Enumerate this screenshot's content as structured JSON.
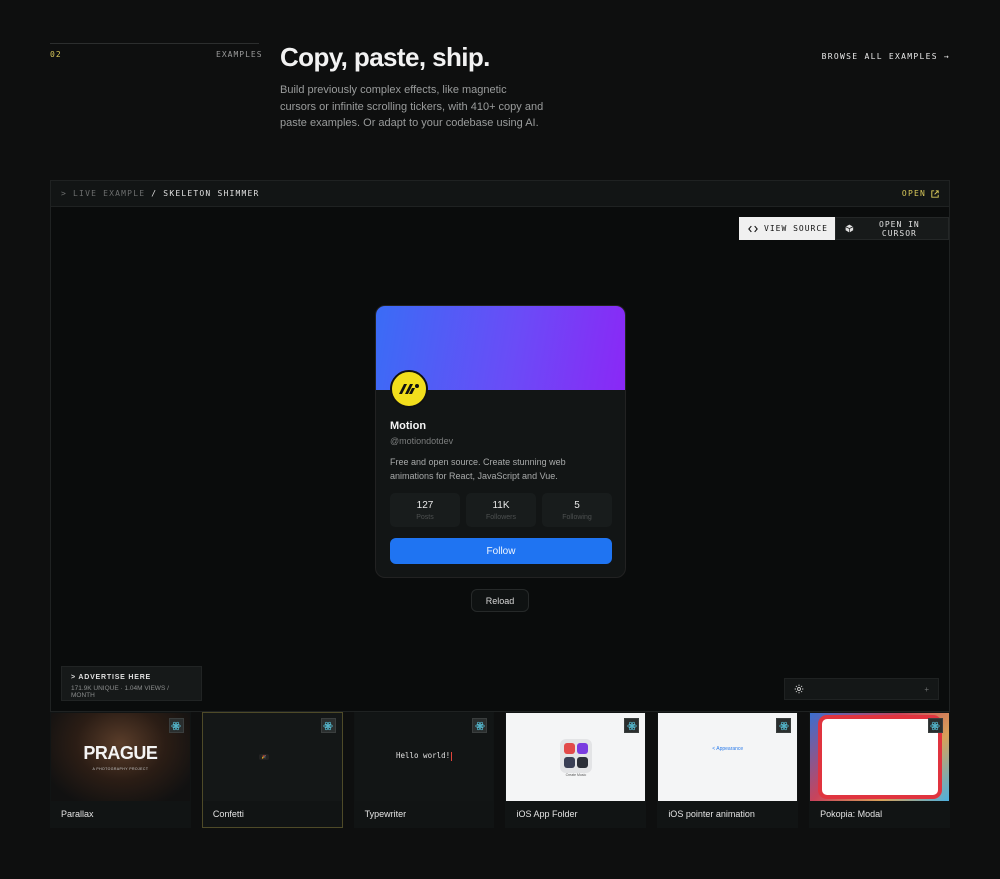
{
  "section": {
    "number": "02",
    "label": "EXAMPLES",
    "title": "Copy, paste, ship.",
    "description": "Build previously complex effects, like magnetic cursors or infinite scrolling tickers, with 410+ copy and paste examples. Or adapt to your codebase using AI.",
    "browse_label": "BROWSE ALL EXAMPLES",
    "browse_arrow": "→"
  },
  "panel": {
    "breadcrumb_prefix": "> LIVE EXAMPLE",
    "breadcrumb_sep": " / ",
    "breadcrumb_current": "SKELETON SHIMMER",
    "open_label": "OPEN",
    "view_source_label": "VIEW SOURCE",
    "open_cursor_label": "OPEN IN CURSOR",
    "reload_label": "Reload"
  },
  "profile": {
    "name": "Motion",
    "handle": "@motiondotdev",
    "bio": "Free and open source. Create stunning web animations for React, JavaScript and Vue.",
    "stats": [
      {
        "value": "127",
        "label": "Posts"
      },
      {
        "value": "11K",
        "label": "Followers"
      },
      {
        "value": "5",
        "label": "Following"
      }
    ],
    "follow_label": "Follow",
    "banner_colors": [
      "#3a6cf6",
      "#8a28f6"
    ],
    "avatar_color": "#f2de1c"
  },
  "ad": {
    "title": "> ADVERTISE HERE",
    "stats": "171.9K UNIQUE · 1.04M VIEWS / MONTH"
  },
  "settings": {
    "plus": "+"
  },
  "thumbnails": [
    {
      "label": "Parallax",
      "art_title": "PRAGUE",
      "art_sub": "A PHOTOGRAPHY PROJECT"
    },
    {
      "label": "Confetti"
    },
    {
      "label": "Typewriter",
      "art_text": "Hello world!"
    },
    {
      "label": "iOS App Folder",
      "art_text": "Create Music"
    },
    {
      "label": "iOS pointer animation",
      "art_text": "< Appearance"
    },
    {
      "label": "Pokopia: Modal"
    }
  ],
  "colors": {
    "accent": "#d9c95a",
    "follow_button": "#1f74f2",
    "background": "#0e0f0f"
  }
}
